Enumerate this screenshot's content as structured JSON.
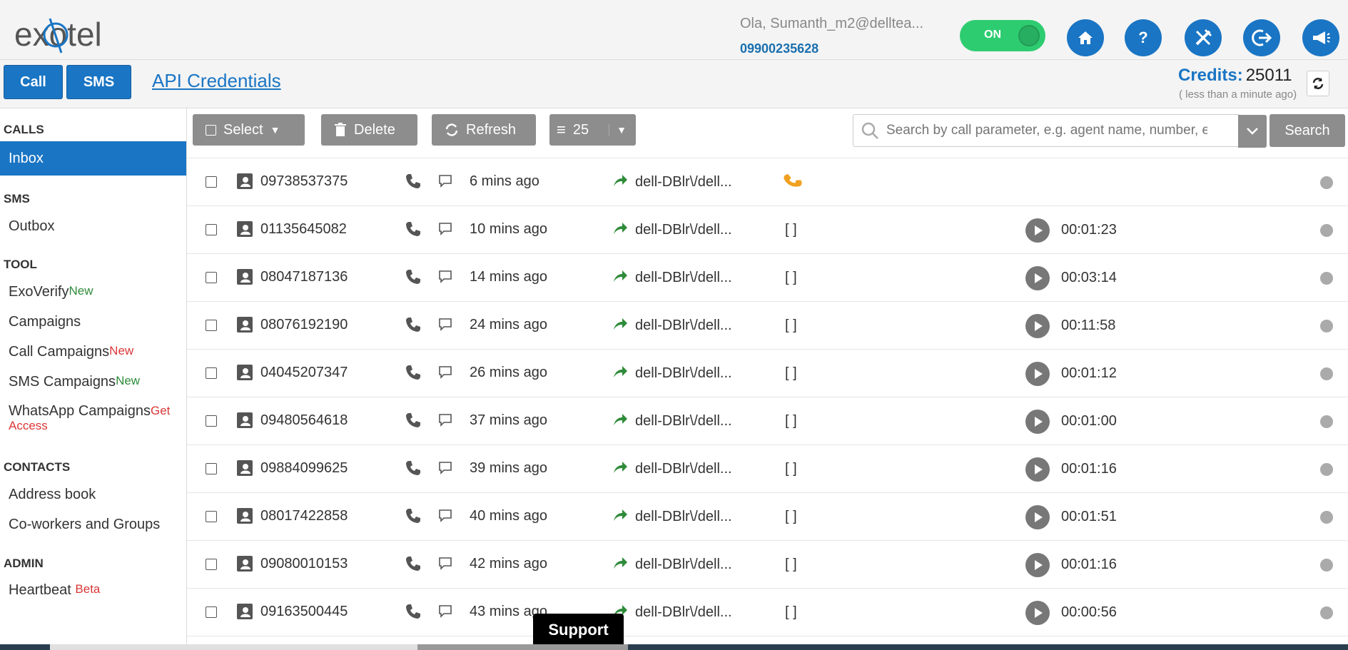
{
  "header": {
    "logo_text": "exotel",
    "user_name": "Ola, Sumanth_m2@delltea...",
    "user_phone": "09900235628",
    "toggle_label": "ON",
    "icons": [
      "home-icon",
      "help-icon",
      "tools-icon",
      "logout-icon",
      "announcement-icon"
    ],
    "accent": "#1a75c4",
    "toggle_color": "#2ecc71"
  },
  "subbar": {
    "call_label": "Call",
    "sms_label": "SMS",
    "api_label": "API Credentials",
    "credits_label": "Credits:",
    "credits_value": "25011",
    "credits_sub": "( less than a minute ago)"
  },
  "sidebar": {
    "sections": [
      {
        "title": "CALLS"
      },
      {
        "title": "SMS"
      },
      {
        "title": "TOOL"
      },
      {
        "title": "CONTACTS"
      },
      {
        "title": "ADMIN"
      }
    ],
    "items": {
      "inbox": "Inbox",
      "outbox": "Outbox",
      "exoverify": "ExoVerify",
      "exoverify_tag": "New",
      "campaigns": "Campaigns",
      "call_campaigns": "Call Campaigns",
      "call_campaigns_tag": "New",
      "sms_campaigns": "SMS Campaigns",
      "sms_campaigns_tag": "New",
      "whatsapp": "WhatsApp Campaigns",
      "whatsapp_tag1": "Get",
      "whatsapp_tag2": "Access",
      "address_book": "Address book",
      "coworkers": "Co-workers and Groups",
      "heartbeat": "Heartbeat",
      "heartbeat_tag": "Beta"
    }
  },
  "toolbar": {
    "select_label": "Select",
    "delete_label": "Delete",
    "refresh_label": "Refresh",
    "page_size": "25",
    "search_placeholder": "Search by call parameter, e.g. agent name, number, etc.",
    "search_label": "Search"
  },
  "calls": [
    {
      "number": "09738537375",
      "ago": "6 mins ago",
      "dest": "dell-DBlr\\/dell...",
      "status": "",
      "duration": ""
    },
    {
      "number": "01135645082",
      "ago": "10 mins ago",
      "dest": "dell-DBlr\\/dell...",
      "status": "[ ]",
      "duration": "00:01:23"
    },
    {
      "number": "08047187136",
      "ago": "14 mins ago",
      "dest": "dell-DBlr\\/dell...",
      "status": "[ ]",
      "duration": "00:03:14"
    },
    {
      "number": "08076192190",
      "ago": "24 mins ago",
      "dest": "dell-DBlr\\/dell...",
      "status": "[ ]",
      "duration": "00:11:58"
    },
    {
      "number": "04045207347",
      "ago": "26 mins ago",
      "dest": "dell-DBlr\\/dell...",
      "status": "[ ]",
      "duration": "00:01:12"
    },
    {
      "number": "09480564618",
      "ago": "37 mins ago",
      "dest": "dell-DBlr\\/dell...",
      "status": "[ ]",
      "duration": "00:01:00"
    },
    {
      "number": "09884099625",
      "ago": "39 mins ago",
      "dest": "dell-DBlr\\/dell...",
      "status": "[ ]",
      "duration": "00:01:16"
    },
    {
      "number": "08017422858",
      "ago": "40 mins ago",
      "dest": "dell-DBlr\\/dell...",
      "status": "[ ]",
      "duration": "00:01:51"
    },
    {
      "number": "09080010153",
      "ago": "42 mins ago",
      "dest": "dell-DBlr\\/dell...",
      "status": "[ ]",
      "duration": "00:01:16"
    },
    {
      "number": "09163500445",
      "ago": "43 mins ago",
      "dest": "dell-DBlr\\/dell...",
      "status": "[ ]",
      "duration": "00:00:56"
    }
  ],
  "support_label": "Support"
}
